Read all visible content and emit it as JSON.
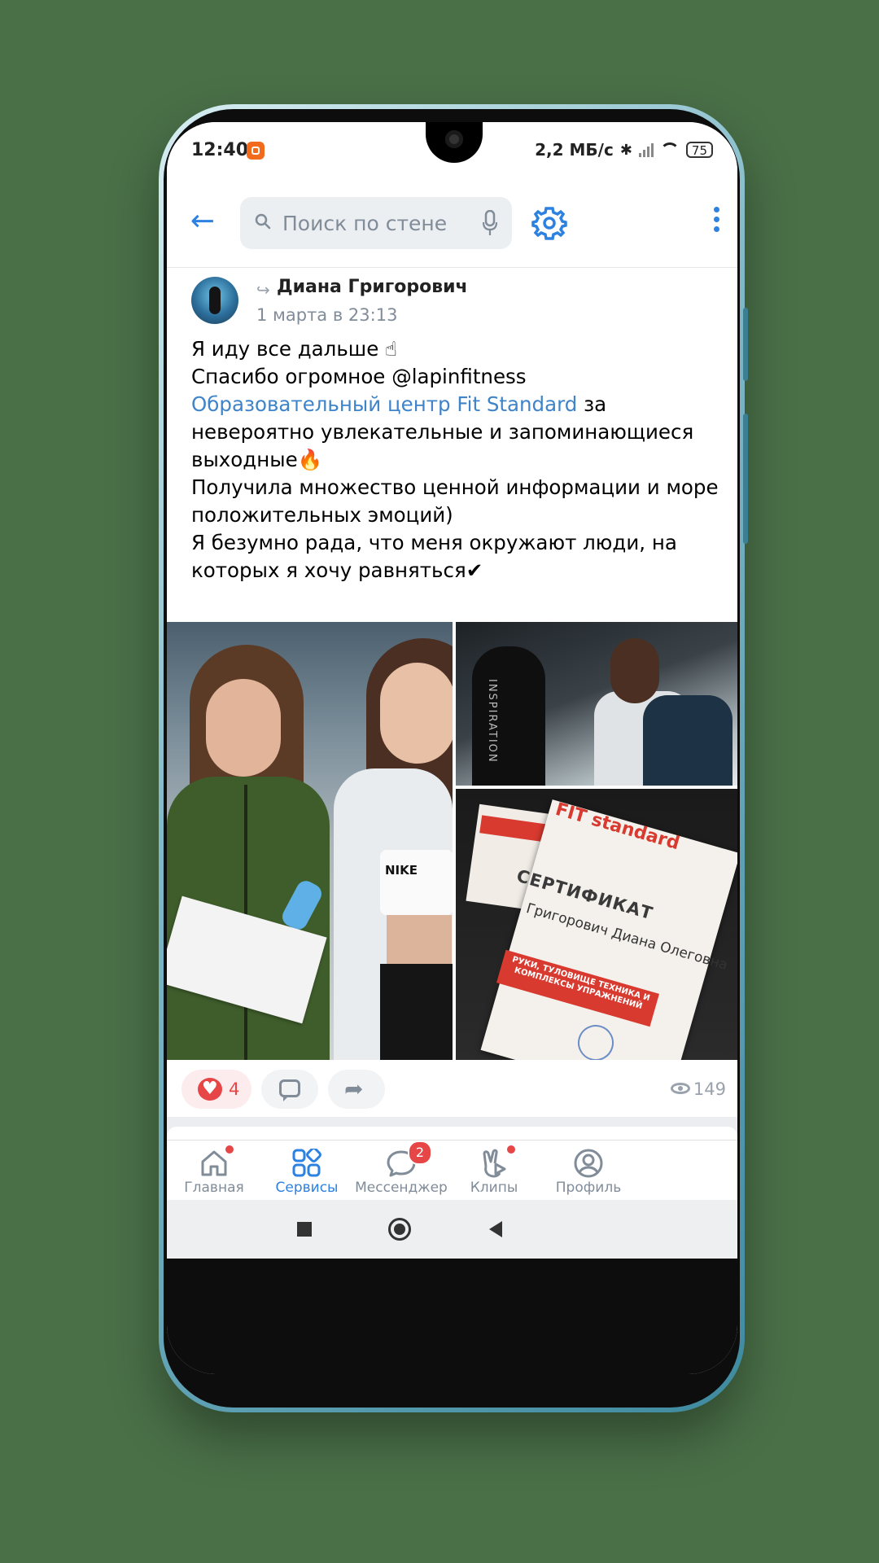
{
  "status_bar": {
    "time": "12:40",
    "speed": "2,2 МБ/с",
    "battery": "75"
  },
  "header": {
    "search_placeholder": "Поиск по стене"
  },
  "post": {
    "author": "Диана Григорович",
    "date": "1 марта в 23:13",
    "line1": "Я иду все дальше ☝",
    "line2_prefix": "Спасибо огромное ",
    "mention": "@lapinfitness",
    "group_link": "Образовательный центр Fit Standard",
    "line2_suffix": "  за невероятно увлекательные и запоминающиеся выходные🔥",
    "line3": "Получила множество ценной информации и море положительных эмоций)",
    "line4": "Я безумно рада, что меня окружают люди, на которых я хочу равняться✔"
  },
  "photos": {
    "tr_label": "INSPIRATION",
    "cert_logo": "FIT standard",
    "cert_title": "СЕРТИФИКАТ",
    "cert_name": "Григорович Диана Олеговна",
    "cert_band": "РУКИ, ТУЛОВИЩЕ ТЕХНИКА И КОМПЛЕКСЫ УПРАЖНЕНИЙ",
    "shirt_brand": "NIKE"
  },
  "actions": {
    "likes": "4",
    "views": "149"
  },
  "tabbar": {
    "items": [
      {
        "label": "Главная"
      },
      {
        "label": "Сервисы"
      },
      {
        "label": "Мессенджер",
        "badge": "2"
      },
      {
        "label": "Клипы"
      },
      {
        "label": "Профиль"
      }
    ]
  },
  "colors": {
    "accent": "#2d81e0",
    "like": "#e64646",
    "background": "#4a7048"
  }
}
